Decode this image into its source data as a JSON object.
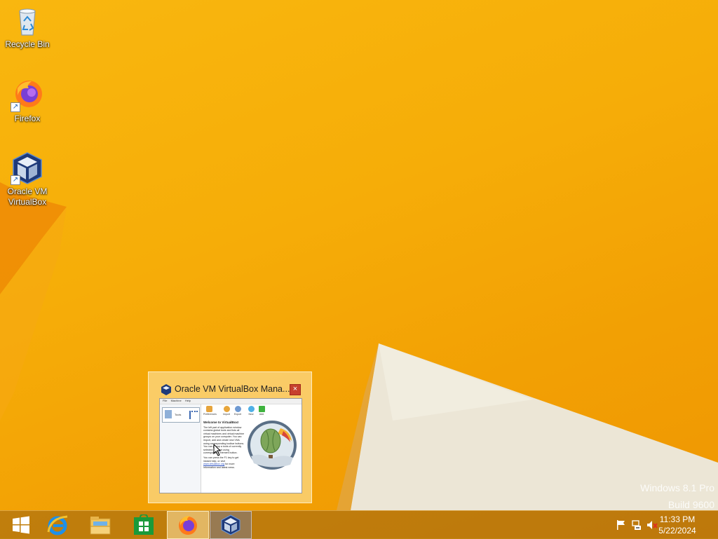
{
  "desktop": {
    "icons": [
      {
        "label_line1": "Recycle Bin",
        "label_line2": "",
        "icon": "recycle-bin-icon"
      },
      {
        "label_line1": "Firefox",
        "label_line2": "",
        "icon": "firefox-icon"
      },
      {
        "label_line1": "Oracle VM",
        "label_line2": "VirtualBox",
        "icon": "virtualbox-icon"
      }
    ],
    "watermark": {
      "line1": "Windows 8.1 Pro",
      "line2": "Build 9600"
    }
  },
  "thumbnail": {
    "title": "Oracle VM VirtualBox Mana...",
    "close_label": "×",
    "mini_window": {
      "menu": [
        "File",
        "Machine",
        "Help"
      ],
      "tools_label": "Tools",
      "toolbar": [
        "Preferences",
        "Import",
        "Export",
        "New",
        "Add"
      ],
      "welcome_title": "Welcome to VirtualBox!",
      "welcome_body": "The left part of application window contains global tools and lists all virtual machines and virtual machine groups on your computer. You can import, add and create new VMs using corresponding toolbar buttons. You can popup a tools of currently selected element using corresponding element button.",
      "help_text": "You can press the F1 key to get instant help, or visit",
      "link_text": "www.virtualbox.org",
      "help_tail": "for more information and latest news."
    }
  },
  "taskbar": {
    "buttons": [
      {
        "name": "start",
        "icon": "windows-logo-icon"
      },
      {
        "name": "internet-explorer",
        "icon": "internet-explorer-icon"
      },
      {
        "name": "file-explorer",
        "icon": "file-explorer-icon"
      },
      {
        "name": "store",
        "icon": "store-icon"
      },
      {
        "name": "firefox",
        "icon": "firefox-icon"
      },
      {
        "name": "virtualbox",
        "icon": "virtualbox-icon"
      }
    ],
    "tray": {
      "icons": [
        "action-center-flag-icon",
        "network-icon",
        "volume-muted-icon"
      ],
      "time": "11:33 PM",
      "date": "5/22/2024"
    }
  },
  "colors": {
    "wallpaper": "#f6ad08",
    "wallpaper_shape": "#ec8a05",
    "taskbar_tint": "#966014"
  }
}
